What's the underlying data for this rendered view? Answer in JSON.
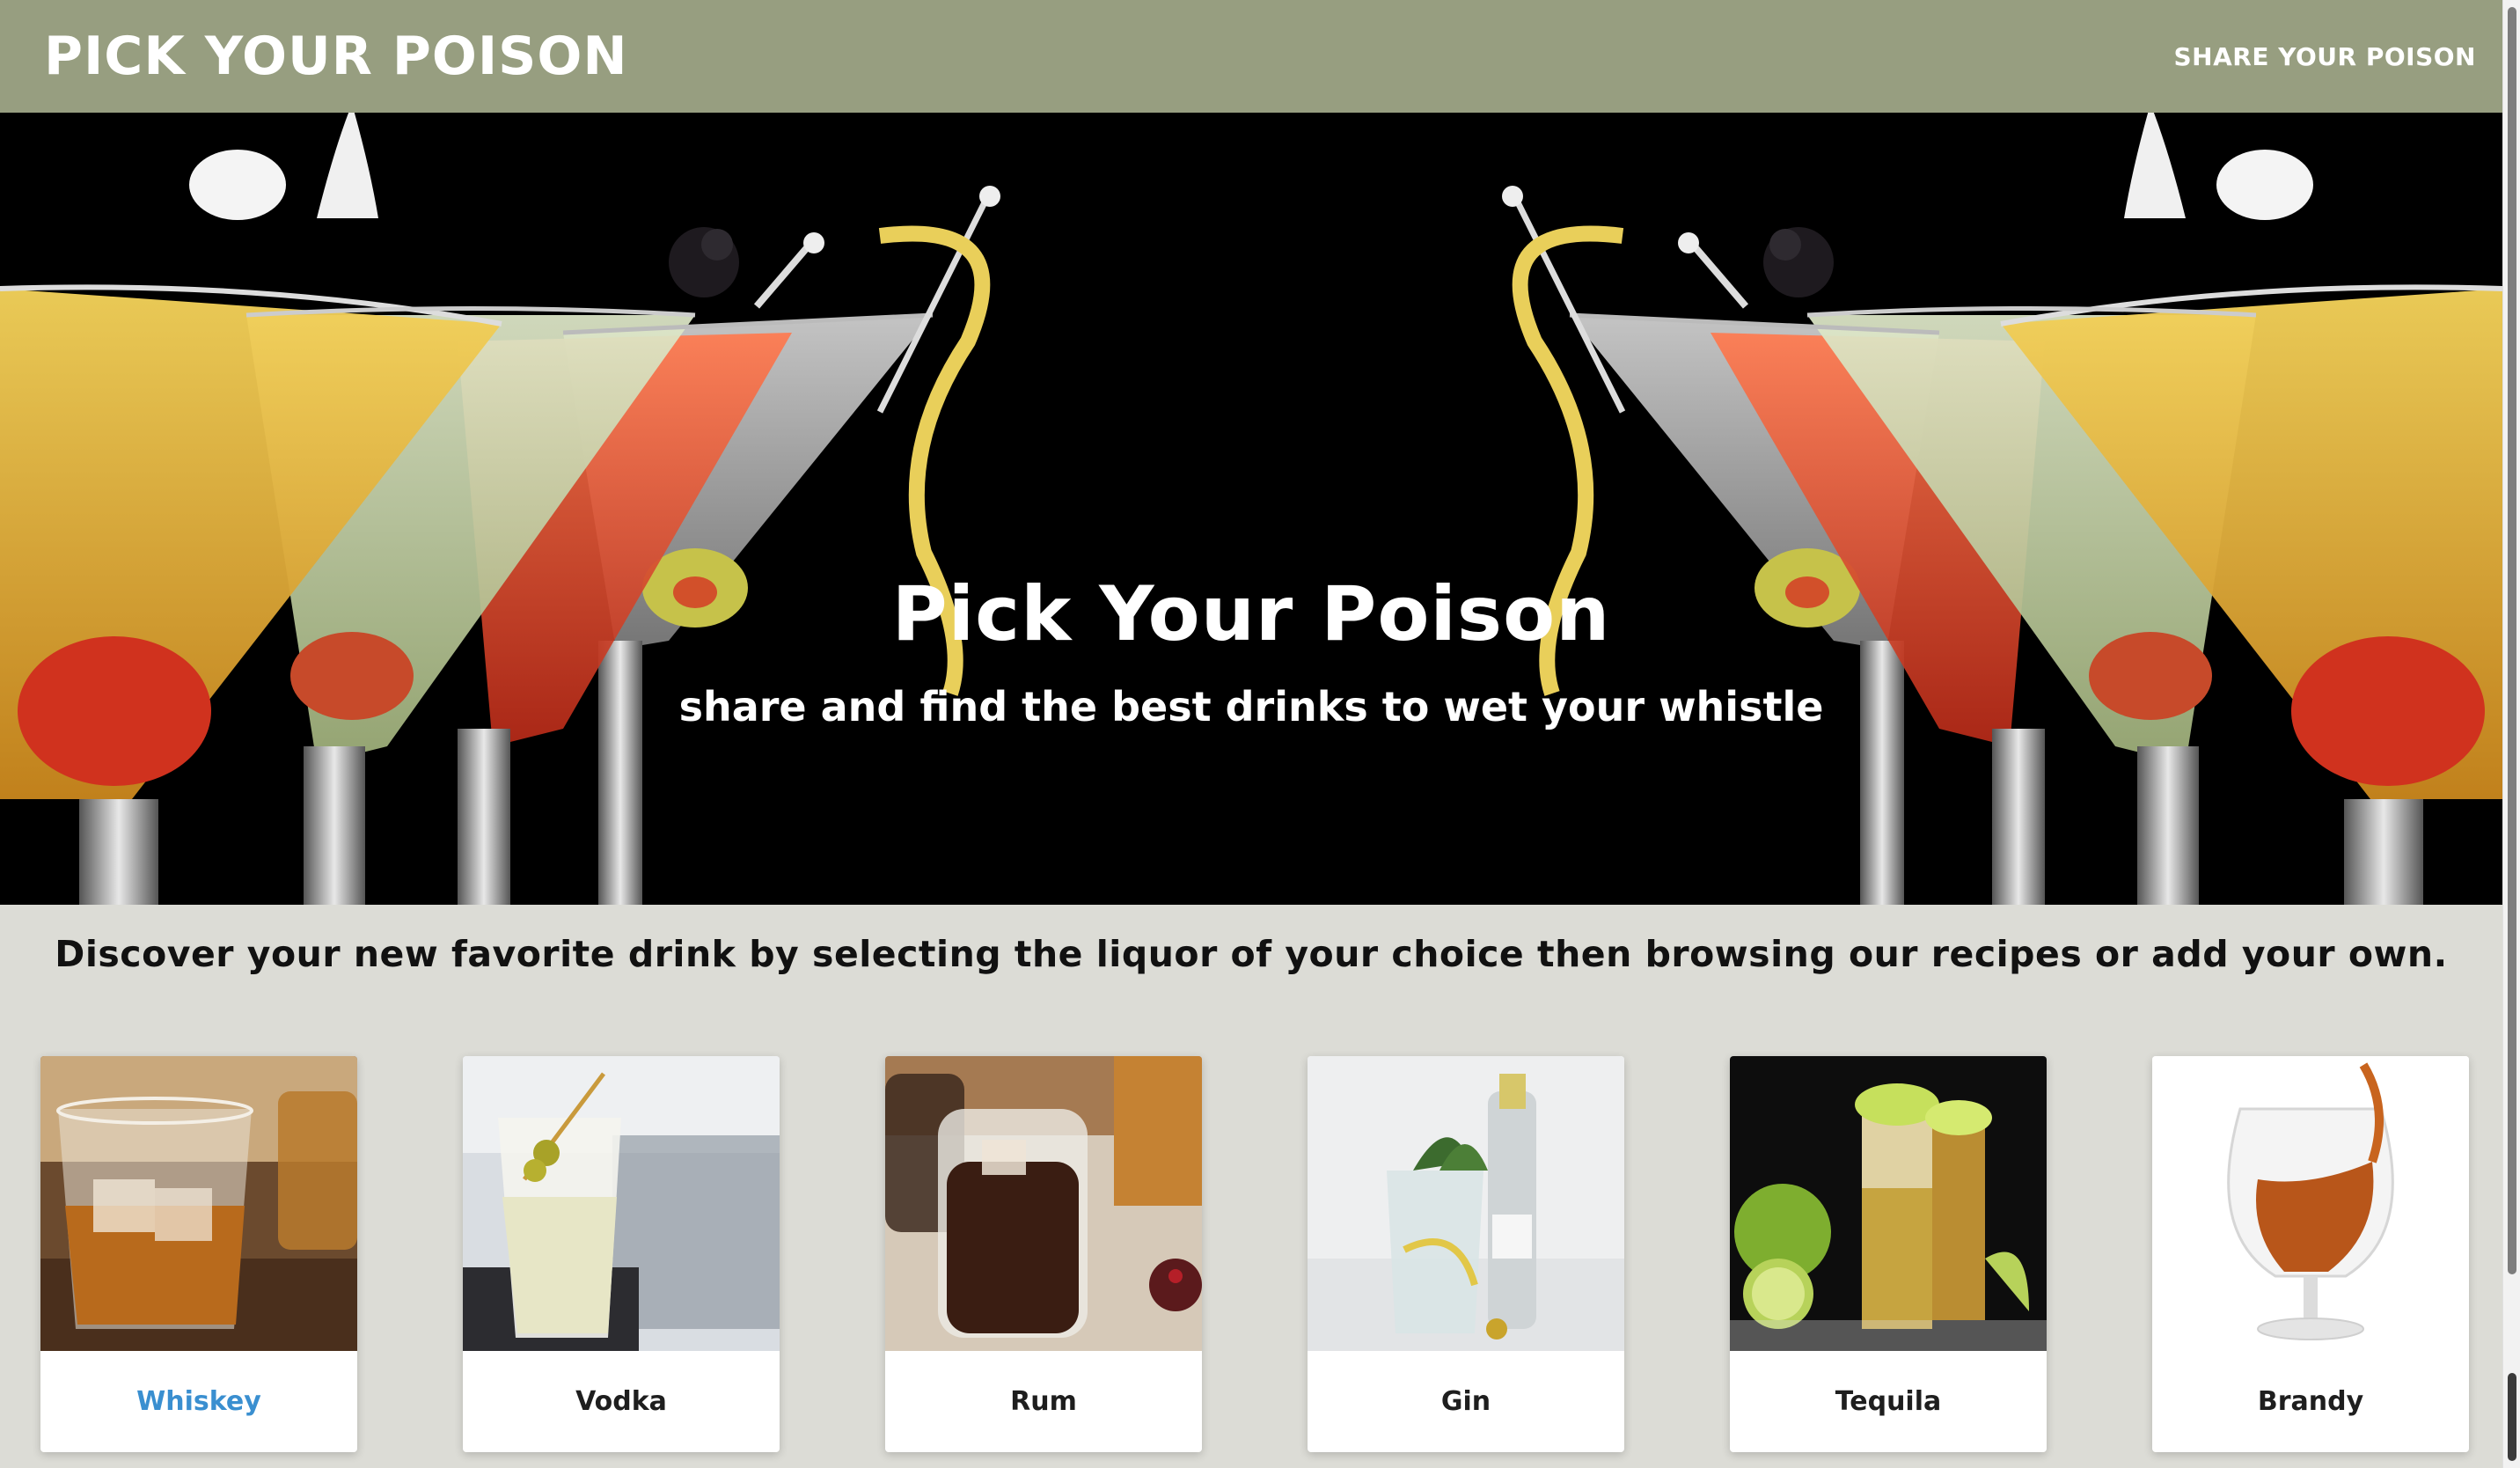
{
  "navbar": {
    "brand": "PICK YOUR POISON",
    "share_link": "SHARE YOUR POISON",
    "bg_color": "#979e80"
  },
  "hero": {
    "title": "Pick Your Poison",
    "subtitle": "share and find the best drinks to wet your whistle"
  },
  "intro": {
    "text": "Discover your new favorite drink by selecting the liquor of your choice then browsing our recipes or add your own."
  },
  "cards": [
    {
      "label": "Whiskey",
      "image": "whiskey-glass-image",
      "active": true
    },
    {
      "label": "Vodka",
      "image": "vodka-martini-image",
      "active": false
    },
    {
      "label": "Rum",
      "image": "rum-cola-jar-image",
      "active": false
    },
    {
      "label": "Gin",
      "image": "gin-tonic-image",
      "active": false
    },
    {
      "label": "Tequila",
      "image": "tequila-shots-lime-image",
      "active": false
    },
    {
      "label": "Brandy",
      "image": "brandy-snifter-image",
      "active": false
    }
  ],
  "colors": {
    "page_bg": "#dcdcd6",
    "active_link": "#3a8fd0"
  }
}
